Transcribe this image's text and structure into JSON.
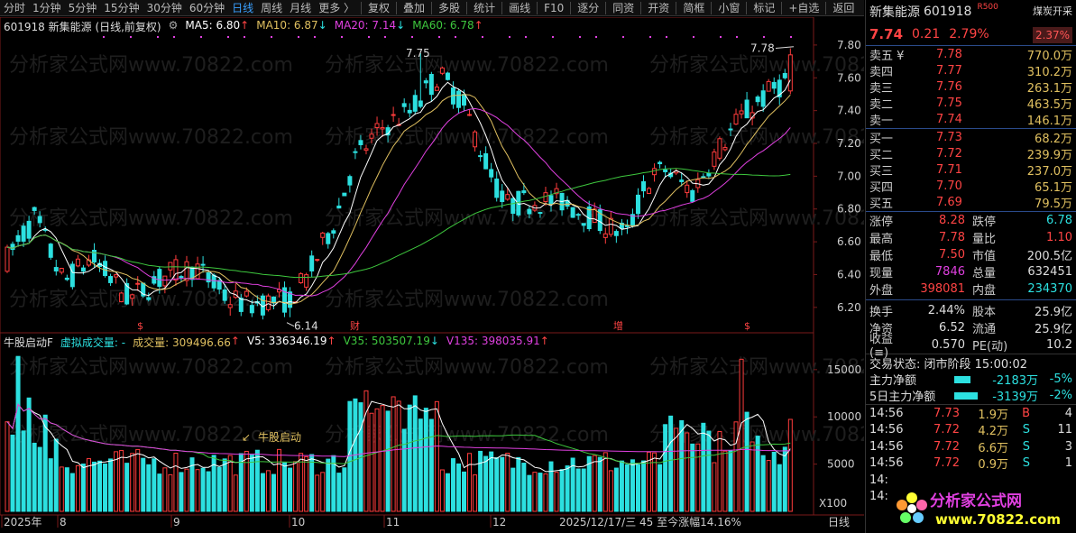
{
  "toolbar": {
    "periods": [
      "分时",
      "1分钟",
      "5分钟",
      "15分钟",
      "30分钟",
      "60分钟",
      "日线",
      "周线",
      "月线",
      "更多 〉"
    ],
    "active_period": "日线",
    "tools": [
      "复权",
      "叠加",
      "多股",
      "统计",
      "画线",
      "F10",
      "逐分",
      "同资",
      "开资",
      "简框",
      "小窗",
      "标记",
      "+自选",
      "返回"
    ]
  },
  "chart": {
    "title": "601918 新集能源 (日线,前复权)",
    "ma_legend": [
      {
        "label": "MA5: 6.80",
        "arrow": "↑",
        "color": "#ffffff"
      },
      {
        "label": "MA10: 6.87",
        "arrow": "↓",
        "color": "#e0c060"
      },
      {
        "label": "MA20: 7.14",
        "arrow": "↓",
        "color": "#e040e0"
      },
      {
        "label": "MA60: 6.78",
        "arrow": "↑",
        "color": "#3ec83e"
      }
    ],
    "price_axis": [
      "7.80",
      "7.60",
      "7.40",
      "7.20",
      "7.00",
      "6.80",
      "6.60",
      "6.40",
      "6.20"
    ],
    "high_label": "7.75",
    "high_label2": "7.78",
    "low_label": "6.14",
    "markers": [
      "$",
      "财",
      "增",
      "$"
    ],
    "vol_legend": [
      {
        "label": "牛股启动F",
        "color": "#dddddd"
      },
      {
        "label": "虚拟成交量: -",
        "color": "#2ce0e0"
      },
      {
        "label": "成交量: 309496.66",
        "arrow": "↑",
        "color": "#e0c060"
      },
      {
        "label": "V5: 336346.19",
        "arrow": "↑",
        "color": "#ffffff"
      },
      {
        "label": "V35: 503507.19",
        "arrow": "↓",
        "color": "#3ec83e"
      },
      {
        "label": "V135: 398035.91",
        "arrow": "↑",
        "color": "#e040e0"
      }
    ],
    "vol_axis": [
      "15000",
      "10000",
      "5000"
    ],
    "vol_unit": "X100",
    "signal_label": "牛股启动",
    "date_axis": [
      "2025年",
      "8",
      "9",
      "10",
      "11",
      "12"
    ],
    "cursor_info": "2025/12/17/三 45 至今涨幅14.16%",
    "period_label": "日线",
    "watermark": "分析家公式网www.70822.com"
  },
  "quote": {
    "name": "新集能源",
    "code": "601918",
    "badge": "R500",
    "sector": "煤炭开采",
    "sector_change": "2.37%",
    "price": "7.74",
    "change": "0.21",
    "change_pct": "2.79%",
    "asks": [
      {
        "label": "卖五 ¥",
        "price": "7.78",
        "qty": "770.0万"
      },
      {
        "label": "卖四",
        "price": "7.77",
        "qty": "310.2万"
      },
      {
        "label": "卖三",
        "price": "7.76",
        "qty": "263.1万"
      },
      {
        "label": "卖二",
        "price": "7.75",
        "qty": "463.5万"
      },
      {
        "label": "卖一",
        "price": "7.74",
        "qty": "146.1万"
      }
    ],
    "bids": [
      {
        "label": "买一",
        "price": "7.73",
        "qty": "68.2万"
      },
      {
        "label": "买二",
        "price": "7.72",
        "qty": "239.9万"
      },
      {
        "label": "买三",
        "price": "7.71",
        "qty": "237.0万"
      },
      {
        "label": "买四",
        "price": "7.70",
        "qty": "65.1万"
      },
      {
        "label": "买五",
        "price": "7.69",
        "qty": "79.5万"
      }
    ],
    "stats": [
      {
        "k": "涨停",
        "v": "8.28",
        "vc": "red",
        "k2": "跌停",
        "v2": "6.78",
        "v2c": "green"
      },
      {
        "k": "最高",
        "v": "7.78",
        "vc": "red",
        "k2": "量比",
        "v2": "1.10",
        "v2c": "red"
      },
      {
        "k": "最低",
        "v": "7.50",
        "vc": "red",
        "k2": "市值",
        "v2": "200.5亿",
        "v2c": "white"
      },
      {
        "k": "现量",
        "v": "7846",
        "vc": "magenta",
        "k2": "总量",
        "v2": "632451",
        "v2c": "white"
      },
      {
        "k": "外盘",
        "v": "398081",
        "vc": "red",
        "k2": "内盘",
        "v2": "234370",
        "v2c": "green"
      }
    ],
    "stats2": [
      {
        "k": "换手",
        "v": "2.44%",
        "vc": "white",
        "k2": "股本",
        "v2": "25.9亿",
        "v2c": "white"
      },
      {
        "k": "净资",
        "v": "6.52",
        "vc": "white",
        "k2": "流通",
        "v2": "25.9亿",
        "v2c": "white"
      },
      {
        "k": "收益(≡)",
        "v": "0.570",
        "vc": "white",
        "k2": "PE(动)",
        "v2": "10.2",
        "v2c": "white"
      }
    ],
    "trade_state": "交易状态: 闭市阶段 15:00:02",
    "flows": [
      {
        "label": "主力净额",
        "value": "-2183万",
        "pct": "-5%",
        "bar": 0.45
      },
      {
        "label": "5日主力净额",
        "value": "-3139万",
        "pct": "-2%",
        "bar": 0.65
      }
    ],
    "ticks": [
      {
        "t": "14:56",
        "p": "7.73",
        "q": "1.9万",
        "bs": "B",
        "n": "4"
      },
      {
        "t": "14:56",
        "p": "7.72",
        "q": "4.2万",
        "bs": "S",
        "n": "11"
      },
      {
        "t": "14:56",
        "p": "7.72",
        "q": "6.6万",
        "bs": "S",
        "n": "3"
      },
      {
        "t": "14:56",
        "p": "7.72",
        "q": "0.9万",
        "bs": "S",
        "n": "1"
      }
    ],
    "ticks_partial": [
      "14:",
      "14:"
    ],
    "logo_text": "分析家公式网",
    "logo_url": "www.70822.com"
  }
}
